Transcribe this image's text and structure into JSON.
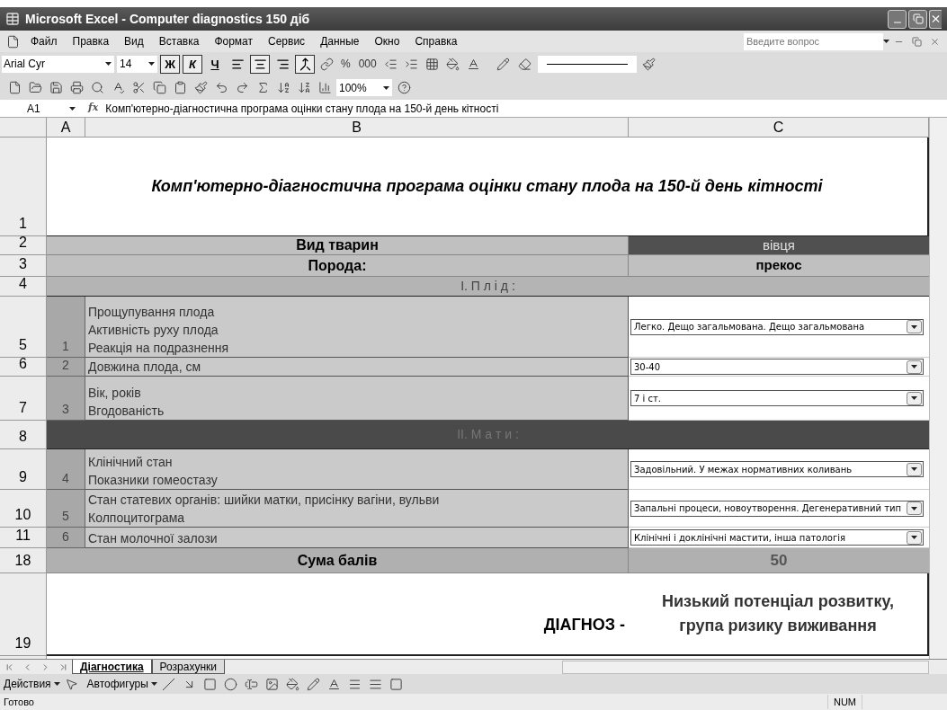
{
  "window": {
    "title": "Microsoft Excel - Computer diagnostics 150 діб"
  },
  "menu": {
    "items": [
      "Файл",
      "Правка",
      "Вид",
      "Вставка",
      "Формат",
      "Сервис",
      "Данные",
      "Окно",
      "Справка"
    ],
    "help_placeholder": "Введите вопрос"
  },
  "formatting": {
    "font": "Arial Cyr",
    "size": "14",
    "style_buttons": [
      {
        "kind": "bold",
        "label": "Ж",
        "selected": true
      },
      {
        "kind": "italic",
        "label": "К",
        "selected": true
      },
      {
        "kind": "underline",
        "label": "Ч",
        "selected": false
      }
    ],
    "align_buttons": [
      {
        "kind": "left",
        "selected": false
      },
      {
        "kind": "center",
        "selected": true
      },
      {
        "kind": "right",
        "selected": false
      },
      {
        "kind": "merge",
        "selected": true
      }
    ],
    "number_buttons": [
      "%",
      "000"
    ]
  },
  "standard": {
    "zoom": "100%"
  },
  "formula_bar": {
    "cell": "A1",
    "fx": "fx",
    "formula": "Комп'ютерно-діагностична програма оцінки стану плода на 150-й день кітності"
  },
  "columns": [
    "A",
    "B",
    "C"
  ],
  "rows": [
    {
      "num": "1",
      "kind": "title",
      "text": "Комп'ютерно-діагностична програма оцінки стану плода на 150-й день кітності"
    },
    {
      "num": "2",
      "kind": "header",
      "dark": true,
      "label": "Вид тварин",
      "value": "вівця"
    },
    {
      "num": "3",
      "kind": "header",
      "dark": false,
      "label": "Порода:",
      "value": "прекос"
    },
    {
      "num": "4",
      "kind": "section",
      "dark": false,
      "text": "І. П л і д :"
    },
    {
      "num": "5",
      "kind": "item",
      "index": "1",
      "lines": [
        "Прощупування плода",
        "Активність руху плода",
        "Реакція на подразнення"
      ],
      "value": "Легко. Дещо загальмована. Дещо загальмована"
    },
    {
      "num": "6",
      "kind": "item",
      "index": "2",
      "lines": [
        "Довжина плода, см"
      ],
      "value": "30-40"
    },
    {
      "num": "7",
      "kind": "item",
      "index": "3",
      "lines": [
        "Вік, років",
        "Вгодованість"
      ],
      "value": "7 і ст."
    },
    {
      "num": "8",
      "kind": "section",
      "dark": true,
      "text": "ІІ. М а т и :"
    },
    {
      "num": "9",
      "kind": "item",
      "index": "4",
      "lines": [
        "Клінічний стан",
        "Показники гомеостазу"
      ],
      "value": "Задовільний. У межах нормативних коливань"
    },
    {
      "num": "10",
      "kind": "item",
      "index": "5",
      "lines": [
        "Стан статевих органів: шийки матки, присінку вагіни, вульви",
        "Колпоцитограма"
      ],
      "value": "Запальні процеси, новоутворення. Дегенеративний тип"
    },
    {
      "num": "11",
      "kind": "item",
      "index": "6",
      "lines": [
        "Стан молочної залози"
      ],
      "value": "Клінічні і доклінічні мастити, інша патологія"
    },
    {
      "num": "18",
      "kind": "total",
      "label": "Сума балів",
      "value": "50"
    },
    {
      "num": "19",
      "kind": "diagnosis",
      "label": "ДІАГНОЗ -",
      "value": "Низький потенціал розвитку, група ризику виживання"
    }
  ],
  "sheet_tabs": [
    {
      "label": "Діагностика",
      "selected": true
    },
    {
      "label": "Розрахунки",
      "selected": false
    }
  ],
  "drawing": {
    "actions": "Действия",
    "autoshapes": "Автофигуры"
  },
  "status_bar": {
    "text": "Готово",
    "indicator": "NUM"
  }
}
